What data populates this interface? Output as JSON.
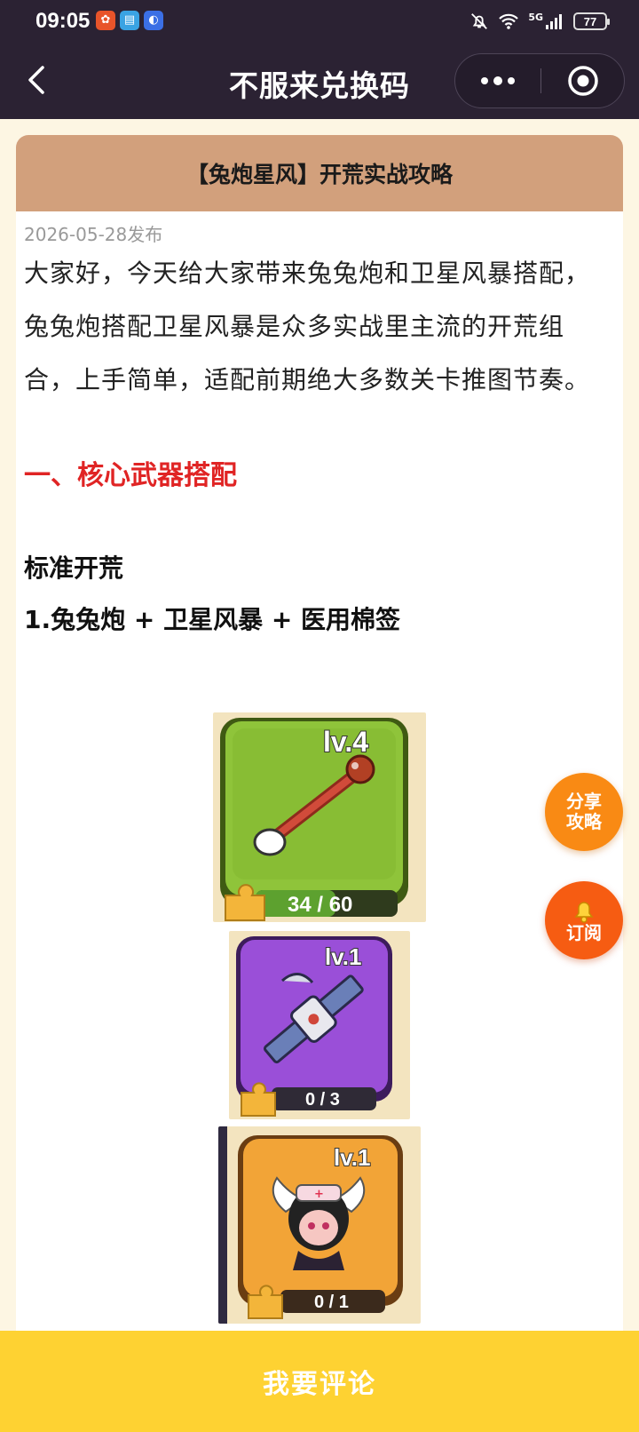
{
  "status_bar": {
    "time": "09:05",
    "network": "5G",
    "battery": "77"
  },
  "nav": {
    "title": "不服来兑换码"
  },
  "article": {
    "title": "【兔炮星风】开荒实战攻略",
    "date": "2026-05-28发布",
    "intro": "大家好，今天给大家带来兔兔炮和卫星风暴搭配，兔兔炮搭配卫星风暴是众多实战里主流的开荒组合，上手简单，适配前期绝大多数关卡推图节奏。",
    "section1_heading": "一、核心武器搭配",
    "subheading": "标准开荒",
    "combo_line": "1.兔兔炮 + 卫星风暴 + 医用棉签"
  },
  "items": [
    {
      "name": "医用棉签",
      "level_label": "lv.4",
      "progress_label": "34 / 60",
      "progress": 0.567,
      "card_color": "#8fc43a"
    },
    {
      "name": "卫星风暴",
      "level_label": "lv.1",
      "progress_label": "0 / 3",
      "progress": 0,
      "card_color": "#9a4fd8"
    },
    {
      "name": "护士",
      "level_label": "lv.1",
      "progress_label": "0 / 1",
      "progress": 0,
      "card_color": "#f2a437"
    }
  ],
  "floating": {
    "share_line1": "分享",
    "share_line2": "攻略",
    "subscribe": "订阅"
  },
  "bottom_bar": {
    "comment_label": "我要评论"
  },
  "colors": {
    "header_bar": "#2b2233",
    "card_header": "#d2a07c",
    "section_red": "#e02424",
    "bottom_bar": "#fed232",
    "fab_share": "#f98a14",
    "fab_subscribe": "#f65c12"
  }
}
